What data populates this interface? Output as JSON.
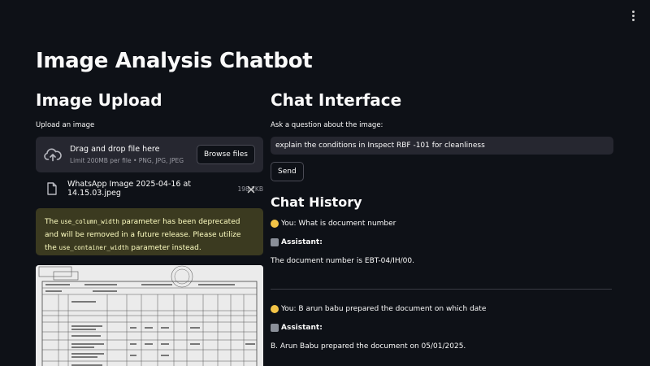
{
  "header": {
    "title": "Image Analysis Chatbot"
  },
  "upload": {
    "heading": "Image Upload",
    "label": "Upload an image",
    "dropzone_title": "Drag and drop file here",
    "dropzone_sub": "Limit 200MB per file • PNG, JPG, JPEG",
    "browse_label": "Browse files",
    "file_name": "WhatsApp Image 2025-04-16 at 14.15.03.jpeg",
    "file_size": "198.2KB"
  },
  "warning": {
    "pre": "The ",
    "code1": "use_column_width",
    "mid": " parameter has been deprecated and will be removed in a future release. Please utilize the ",
    "code2": "use_container_width",
    "post": " parameter instead."
  },
  "chat": {
    "heading": "Chat Interface",
    "input_label": "Ask a question about the image:",
    "input_value": "explain the conditions in Inspect RBF -101 for cleanliness",
    "send_label": "Send"
  },
  "history": {
    "heading": "Chat History",
    "messages": [
      {
        "user": "You: What is document number",
        "assistant_label": "Assistant:",
        "reply": "The document number is EBT-04/IH/00."
      },
      {
        "user": "You: B arun babu prepared the document on which date",
        "assistant_label": "Assistant:",
        "reply": "B. Arun Babu prepared the document on 05/01/2025."
      }
    ]
  },
  "icons": {
    "menu": "vertical-ellipsis-icon",
    "upload": "cloud-upload-icon",
    "file": "file-icon",
    "close": "close-icon",
    "user": "user-emoji-icon",
    "assistant": "robot-emoji-icon"
  },
  "colors": {
    "background": "#0e1117",
    "panel": "#262730",
    "warning_bg": "#3b3a20",
    "warning_text": "#ffffc2",
    "muted": "#9a9ba3"
  }
}
